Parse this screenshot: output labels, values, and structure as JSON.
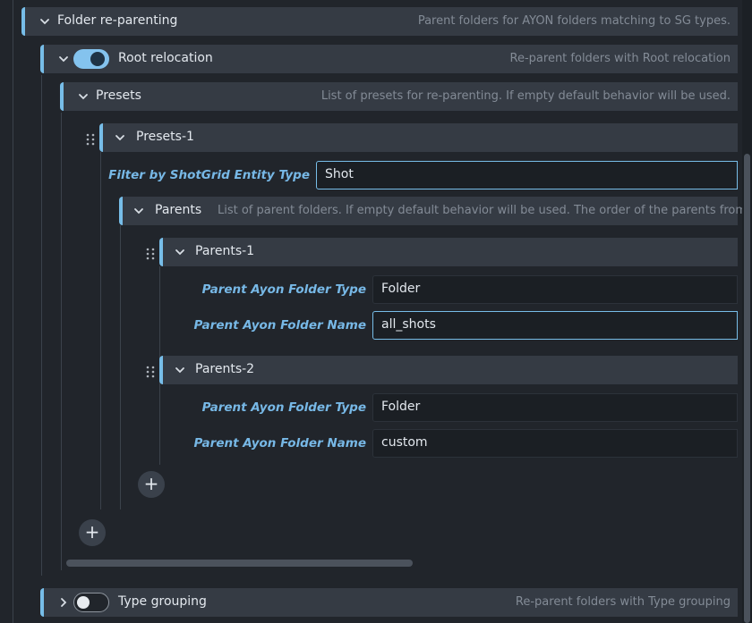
{
  "folder_reparenting": {
    "title": "Folder re-parenting",
    "description": "Parent folders for AYON folders matching to SG types."
  },
  "root_relocation": {
    "title": "Root relocation",
    "description": "Re-parent folders with Root relocation",
    "enabled": true
  },
  "presets": {
    "title": "Presets",
    "description": "List of presets for re-parenting. If empty default behavior will be used."
  },
  "preset_1": {
    "title": "Presets-1",
    "filter_label": "Filter by ShotGrid Entity Type",
    "filter_value": "Shot",
    "parents": {
      "title": "Parents",
      "description": "List of parent folders. If empty default behavior will be used. The order of the parents from"
    },
    "parent_items": [
      {
        "title": "Parents-1",
        "type_label": "Parent Ayon Folder Type",
        "type_value": "Folder",
        "name_label": "Parent Ayon Folder Name",
        "name_value": "all_shots"
      },
      {
        "title": "Parents-2",
        "type_label": "Parent Ayon Folder Type",
        "type_value": "Folder",
        "name_label": "Parent Ayon Folder Name",
        "name_value": "custom"
      }
    ]
  },
  "add_label": "+",
  "type_grouping": {
    "title": "Type grouping",
    "description": "Re-parent folders with Type grouping",
    "enabled": false
  },
  "colors": {
    "accent": "#77bde8",
    "label": "#77b8e6",
    "header_bg": "#353b44",
    "panel_bg": "#21252b",
    "field_bg": "#1b1f24"
  },
  "icons": {
    "collapse": "chevron-down-icon",
    "expand": "chevron-right-icon",
    "drag": "drag-handle-icon",
    "add": "plus-icon"
  }
}
